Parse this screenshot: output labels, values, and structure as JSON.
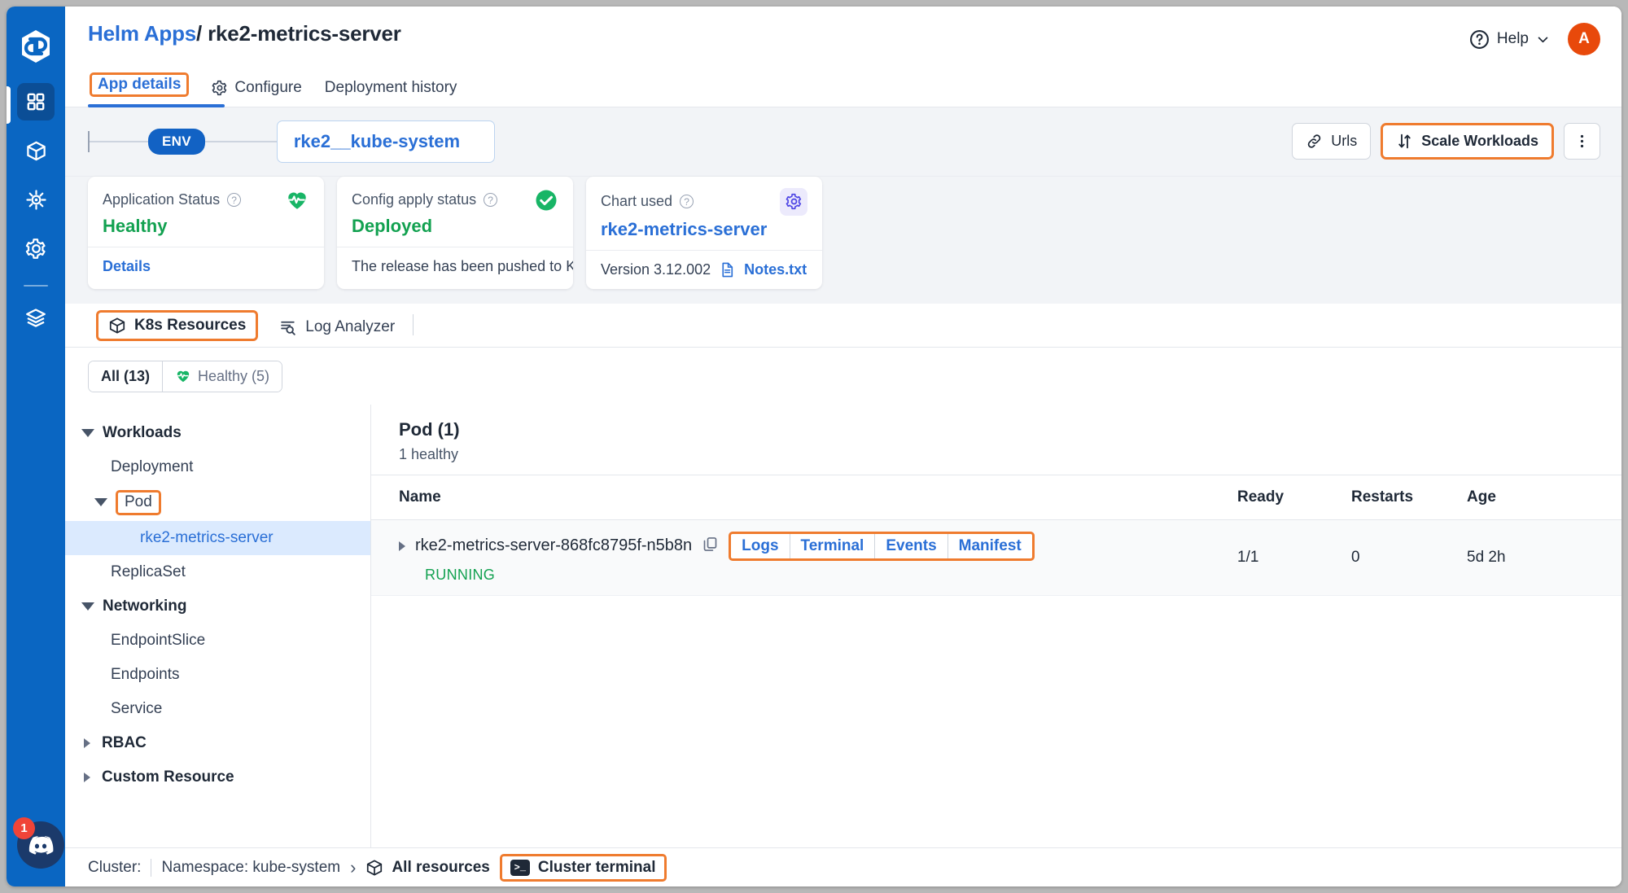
{
  "app": {
    "accent_orange": "#ef7b2e",
    "accent_blue": "#2a6fd6",
    "rail_blue": "#0a66c2",
    "green": "#12a150"
  },
  "rail": {
    "items": [
      {
        "name": "logo",
        "icon": "devtron-logo"
      },
      {
        "name": "applications",
        "icon": "grid-icon",
        "active": true
      },
      {
        "name": "resource-browser",
        "icon": "cube-icon",
        "active": false
      },
      {
        "name": "helm-chart",
        "icon": "ship-wheel-icon",
        "active": false
      },
      {
        "name": "global-config",
        "icon": "gear-icon",
        "active": false
      },
      {
        "name": "stack-manager",
        "icon": "layers-icon",
        "active": false
      }
    ],
    "discord_badge": "1"
  },
  "header": {
    "breadcrumb_root": "Helm Apps",
    "breadcrumb_sep": "/",
    "breadcrumb_current": "rke2-metrics-server",
    "help_label": "Help",
    "avatar_initial": "A",
    "tabs": [
      {
        "label": "App details",
        "selected": true,
        "icon": null
      },
      {
        "label": "Configure",
        "selected": false,
        "icon": "gear-icon"
      },
      {
        "label": "Deployment history",
        "selected": false,
        "icon": null
      }
    ]
  },
  "envbar": {
    "env_pill": "ENV",
    "env_name": "rke2__kube-system",
    "urls_label": "Urls",
    "scale_label": "Scale Workloads",
    "more_label": "⋮"
  },
  "cards": [
    {
      "title": "Application Status",
      "value": "Healthy",
      "value_color": "green",
      "icon": "heartbeat-icon",
      "footer_text": "",
      "footer_link": "Details"
    },
    {
      "title": "Config apply status",
      "value": "Deployed",
      "value_color": "green",
      "icon": "check-circle-icon",
      "footer_text": "The release has been pushed to Kuber…",
      "footer_link": ""
    },
    {
      "title": "Chart used",
      "value": "rke2-metrics-server",
      "value_color": "blue",
      "icon": "chart-gear-icon",
      "footer_text": "Version 3.12.002",
      "footer_link": "Notes.txt"
    }
  ],
  "section_tabs": [
    {
      "label": "K8s Resources",
      "icon": "cube-icon",
      "selected": true
    },
    {
      "label": "Log Analyzer",
      "icon": "log-search-icon",
      "selected": false
    }
  ],
  "filters": [
    {
      "label": "All (13)",
      "selected": true,
      "icon": null
    },
    {
      "label": "Healthy (5)",
      "selected": false,
      "icon": "heartbeat-icon"
    }
  ],
  "tree": [
    {
      "label": "Workloads",
      "level": 0,
      "caret": "down",
      "group": true
    },
    {
      "label": "Deployment",
      "level": 1,
      "caret": "none",
      "group": false
    },
    {
      "label": "Pod",
      "level": 1,
      "caret": "down",
      "group": false,
      "highlight": true
    },
    {
      "label": "rke2-metrics-server",
      "level": 2,
      "caret": "none",
      "group": false,
      "selected": true
    },
    {
      "label": "ReplicaSet",
      "level": 1,
      "caret": "none",
      "group": false
    },
    {
      "label": "Networking",
      "level": 0,
      "caret": "down",
      "group": true
    },
    {
      "label": "EndpointSlice",
      "level": 1,
      "caret": "none",
      "group": false
    },
    {
      "label": "Endpoints",
      "level": 1,
      "caret": "none",
      "group": false
    },
    {
      "label": "Service",
      "level": 1,
      "caret": "none",
      "group": false
    },
    {
      "label": "RBAC",
      "level": 0,
      "caret": "right",
      "group": true
    },
    {
      "label": "Custom Resource",
      "level": 0,
      "caret": "right",
      "group": true
    }
  ],
  "pane": {
    "title": "Pod (1)",
    "subtitle": "1 healthy",
    "columns": [
      "Name",
      "Ready",
      "Restarts",
      "Age"
    ],
    "rows": [
      {
        "name": "rke2-metrics-server-868fc8795f-n5b8n",
        "status": "RUNNING",
        "actions": [
          "Logs",
          "Terminal",
          "Events",
          "Manifest"
        ],
        "ready": "1/1",
        "restarts": "0",
        "age": "5d 2h"
      }
    ]
  },
  "bottombar": {
    "cluster_label": "Cluster:",
    "namespace_label": "Namespace: kube-system",
    "chevron": "›",
    "all_resources": "All resources",
    "cluster_terminal": "Cluster terminal"
  }
}
